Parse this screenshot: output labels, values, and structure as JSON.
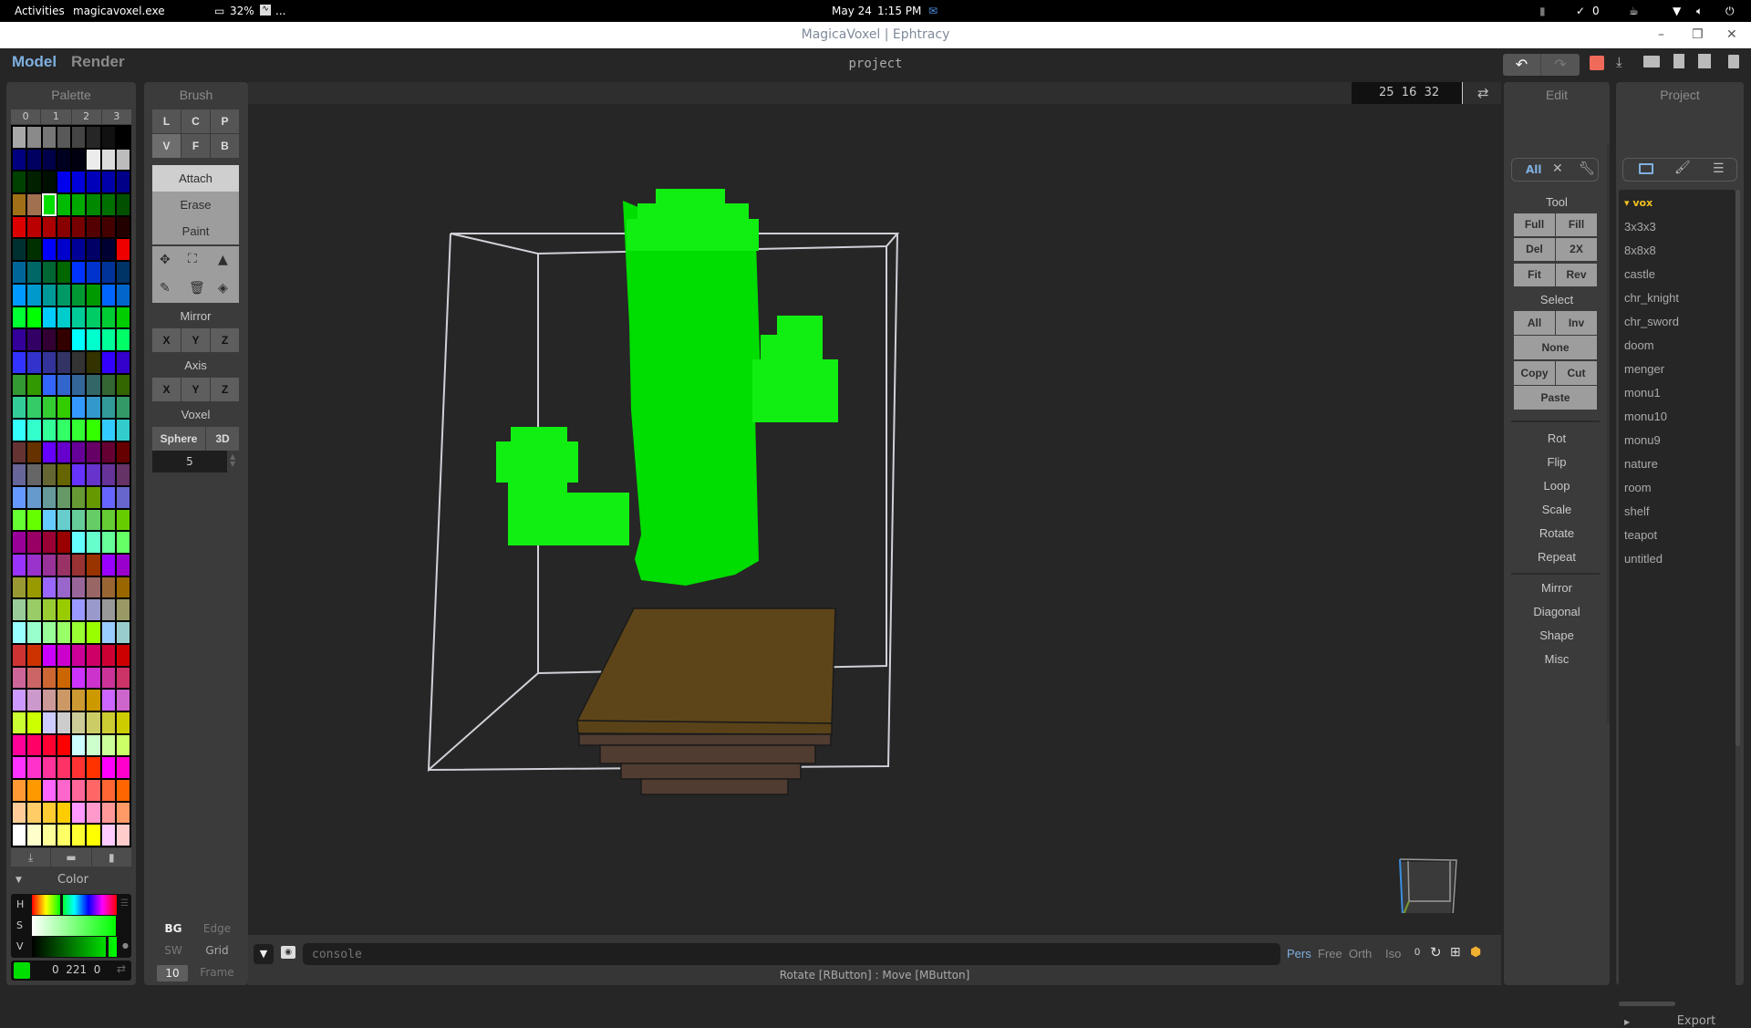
{
  "system_bar": {
    "activities": "Activities",
    "app_name": "magicavoxel.exe",
    "cpu_label": "32%",
    "more": "...",
    "date": "May 24",
    "time": "1:15 PM",
    "check_count": "0"
  },
  "window": {
    "title": "MagicaVoxel | Ephtracy",
    "minimize": "–",
    "maximize": "❐",
    "close": "✕"
  },
  "header": {
    "tabs": [
      {
        "label": "Model",
        "active": true
      },
      {
        "label": "Render",
        "active": false
      }
    ],
    "project_name": "project",
    "dimensions": "25  16  32",
    "swap_icon": "⇄"
  },
  "toolbar_icons": [
    "undo-icon",
    "redo-icon",
    "save-icon",
    "export-icon",
    "open-folder-icon",
    "new-file-icon",
    "duplicate-icon",
    "delete-icon"
  ],
  "palette": {
    "title": "Palette",
    "pages": [
      "0",
      "1",
      "2",
      "3"
    ],
    "selected_index": 26,
    "colors": [
      "#a8a8a8",
      "#8a8a8a",
      "#777777",
      "#595959",
      "#444444",
      "#262626",
      "#111111",
      "#000000",
      "#000080",
      "#000060",
      "#000048",
      "#000020",
      "#000010",
      "#ececec",
      "#dcdcdc",
      "#bcbcbc",
      "#004000",
      "#002000",
      "#001000",
      "#0000ee",
      "#0000dd",
      "#0000bb",
      "#0000aa",
      "#000088",
      "#a07018",
      "#a07050",
      "#00dd00",
      "#00bb00",
      "#00aa00",
      "#008800",
      "#007000",
      "#005000",
      "#dd0000",
      "#bb0000",
      "#aa0000",
      "#880000",
      "#770000",
      "#550000",
      "#440000",
      "#220000",
      "#003030",
      "#003000",
      "#0000ff",
      "#0000cc",
      "#000099",
      "#000066",
      "#000033",
      "#ee0000",
      "#006699",
      "#006666",
      "#006633",
      "#006600",
      "#0033ff",
      "#0033cc",
      "#003399",
      "#003366",
      "#0099ff",
      "#0099cc",
      "#009999",
      "#009966",
      "#009933",
      "#009900",
      "#0066ff",
      "#0066cc",
      "#00ff33",
      "#00ff00",
      "#00ccff",
      "#00cccc",
      "#00cc99",
      "#00cc66",
      "#00cc33",
      "#00cc00",
      "#330099",
      "#330066",
      "#330033",
      "#330000",
      "#00ffff",
      "#00ffcc",
      "#00ff99",
      "#00ff66",
      "#3333ff",
      "#3333cc",
      "#333399",
      "#333366",
      "#333333",
      "#333300",
      "#3300ff",
      "#3300cc",
      "#339933",
      "#339900",
      "#3366ff",
      "#3366cc",
      "#336699",
      "#336666",
      "#336633",
      "#336600",
      "#33cc99",
      "#33cc66",
      "#33cc33",
      "#33cc00",
      "#3399ff",
      "#3399cc",
      "#339999",
      "#339966",
      "#33ffff",
      "#33ffcc",
      "#33ff99",
      "#33ff66",
      "#33ff33",
      "#33ff00",
      "#33ccff",
      "#33cccc",
      "#663333",
      "#663300",
      "#6600ff",
      "#6600cc",
      "#660099",
      "#660066",
      "#660033",
      "#660000",
      "#666699",
      "#666666",
      "#666633",
      "#666600",
      "#6633ff",
      "#6633cc",
      "#663399",
      "#663366",
      "#6699ff",
      "#6699cc",
      "#669999",
      "#669966",
      "#669933",
      "#669900",
      "#6666ff",
      "#6666cc",
      "#66ff33",
      "#66ff00",
      "#66ccff",
      "#66cccc",
      "#66cc99",
      "#66cc66",
      "#66cc33",
      "#66cc00",
      "#990099",
      "#990066",
      "#990033",
      "#990000",
      "#66ffff",
      "#66ffcc",
      "#66ff99",
      "#66ff66",
      "#9933ff",
      "#9933cc",
      "#993399",
      "#993366",
      "#993333",
      "#993300",
      "#9900ff",
      "#9900cc",
      "#999933",
      "#999900",
      "#9966ff",
      "#9966cc",
      "#996699",
      "#996666",
      "#996633",
      "#996600",
      "#99cc99",
      "#99cc66",
      "#99cc33",
      "#99cc00",
      "#9999ff",
      "#9999cc",
      "#999999",
      "#999966",
      "#99ffff",
      "#99ffcc",
      "#99ff99",
      "#99ff66",
      "#99ff33",
      "#99ff00",
      "#99ccff",
      "#99cccc",
      "#cc3333",
      "#cc3300",
      "#cc00ff",
      "#cc00cc",
      "#cc0099",
      "#cc0066",
      "#cc0033",
      "#cc0000",
      "#cc6699",
      "#cc6666",
      "#cc6633",
      "#cc6600",
      "#cc33ff",
      "#cc33cc",
      "#cc3399",
      "#cc3366",
      "#cc99ff",
      "#cc99cc",
      "#cc9999",
      "#cc9966",
      "#cc9933",
      "#cc9900",
      "#cc66ff",
      "#cc66cc",
      "#ccff33",
      "#ccff00",
      "#ccccff",
      "#cccccc",
      "#cccc99",
      "#cccc66",
      "#cccc33",
      "#cccc00",
      "#ff0099",
      "#ff0066",
      "#ff0033",
      "#ff0000",
      "#ccffff",
      "#ccffcc",
      "#ccff99",
      "#ccff66",
      "#ff33ff",
      "#ff33cc",
      "#ff3399",
      "#ff3366",
      "#ff3333",
      "#ff3300",
      "#ff00ff",
      "#ff00cc",
      "#ff9933",
      "#ff9900",
      "#ff66ff",
      "#ff66cc",
      "#ff6699",
      "#ff6666",
      "#ff6633",
      "#ff6600",
      "#ffcc99",
      "#ffcc66",
      "#ffcc33",
      "#ffcc00",
      "#ff99ff",
      "#ff99cc",
      "#ff9999",
      "#ff9966",
      "#ffffff",
      "#ffffcc",
      "#ffff99",
      "#ffff66",
      "#ffff33",
      "#ffff00",
      "#ffccff",
      "#ffcccc"
    ]
  },
  "color_panel": {
    "title": "Color",
    "h_label": "H",
    "s_label": "S",
    "v_label": "V",
    "rgb_value": "0  221  0",
    "current_color": "#00dd00",
    "hue_fraction": 0.33,
    "value_fraction": 0.87
  },
  "brush": {
    "title": "Brush",
    "shape_buttons": [
      "L",
      "C",
      "P",
      "V",
      "F",
      "B"
    ],
    "active_shape": "V",
    "modes": [
      "Attach",
      "Erase",
      "Paint"
    ],
    "active_mode": "Attach",
    "tool_icons": [
      "move-icon",
      "select-box-icon",
      "pointer-icon",
      "eyedropper-icon",
      "trash-icon",
      "fill-bucket-icon"
    ],
    "mirror_label": "Mirror",
    "mirror_axes": [
      "X",
      "Y",
      "Z"
    ],
    "axis_label": "Axis",
    "axis_axes": [
      "X",
      "Y",
      "Z"
    ],
    "voxel_label": "Voxel",
    "voxel_shape": "Sphere",
    "voxel_mode": "3D",
    "voxel_size": "5"
  },
  "display_options": {
    "bg": "BG",
    "edge": "Edge",
    "sw": "SW",
    "grid": "Grid",
    "frame_value": "10",
    "frame": "Frame"
  },
  "edit_panel": {
    "title": "Edit",
    "filter_tabs": [
      "All",
      "fit-icon",
      "wrench-icon"
    ],
    "tool_label": "Tool",
    "tool_buttons": [
      "Full",
      "Fill",
      "Del",
      "2X",
      "Fit",
      "Rev"
    ],
    "select_label": "Select",
    "select_buttons": {
      "all": "All",
      "inv": "Inv",
      "none": "None",
      "copy": "Copy",
      "cut": "Cut",
      "paste": "Paste"
    },
    "transform_items": [
      "Rot",
      "Flip",
      "Loop",
      "Scale",
      "Rotate",
      "Repeat"
    ],
    "gen_items": [
      "Mirror",
      "Diagonal",
      "Shape",
      "Misc"
    ]
  },
  "project_panel": {
    "title": "Project",
    "folder": "vox",
    "files": [
      "3x3x3",
      "8x8x8",
      "castle",
      "chr_knight",
      "chr_sword",
      "doom",
      "menger",
      "monu1",
      "monu10",
      "monu9",
      "nature",
      "room",
      "shelf",
      "teapot",
      "untitled"
    ],
    "export_label": "Export"
  },
  "viewport": {
    "model_colors": {
      "cactus": "#00dd00",
      "cactus_light": "#11ee11",
      "pot_top": "#5e4519",
      "pot_side": "#503c30"
    },
    "camera_modes": [
      "Pers",
      "Free",
      "Orth",
      "Iso"
    ],
    "active_camera": "Pers",
    "camera_angle": "0",
    "console_placeholder": "console",
    "status_hint": "Rotate [RButton] : Move [MButton]"
  }
}
